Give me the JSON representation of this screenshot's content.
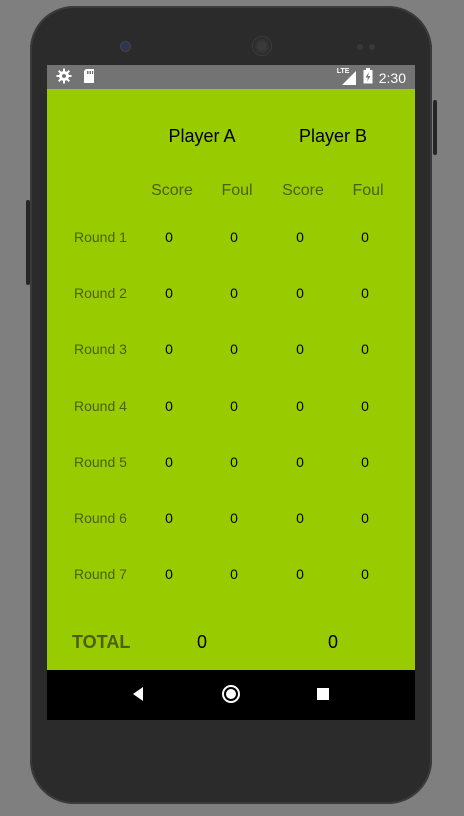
{
  "status_bar": {
    "time": "2:30",
    "network": "LTE",
    "icons": [
      "settings-icon",
      "sd-card-icon",
      "signal-icon",
      "battery-charging-icon"
    ]
  },
  "header": {
    "player_a": "Player A",
    "player_b": "Player B"
  },
  "columns": [
    "Score",
    "Foul",
    "Score",
    "Foul"
  ],
  "rounds": [
    {
      "label": "Round 1",
      "values": [
        "0",
        "0",
        "0",
        "0"
      ]
    },
    {
      "label": "Round 2",
      "values": [
        "0",
        "0",
        "0",
        "0"
      ]
    },
    {
      "label": "Round 3",
      "values": [
        "0",
        "0",
        "0",
        "0"
      ]
    },
    {
      "label": "Round 4",
      "values": [
        "0",
        "0",
        "0",
        "0"
      ]
    },
    {
      "label": "Round 5",
      "values": [
        "0",
        "0",
        "0",
        "0"
      ]
    },
    {
      "label": "Round 6",
      "values": [
        "0",
        "0",
        "0",
        "0"
      ]
    },
    {
      "label": "Round 7",
      "values": [
        "0",
        "0",
        "0",
        "0"
      ]
    }
  ],
  "total": {
    "label": "TOTAL",
    "player_a": "0",
    "player_b": "0"
  },
  "nav_bar": {
    "icons": [
      "back-icon",
      "home-icon",
      "recents-icon"
    ]
  },
  "colors": {
    "background": "#99cc00",
    "muted_text": "#4d5f10",
    "status_bar": "#737373"
  }
}
